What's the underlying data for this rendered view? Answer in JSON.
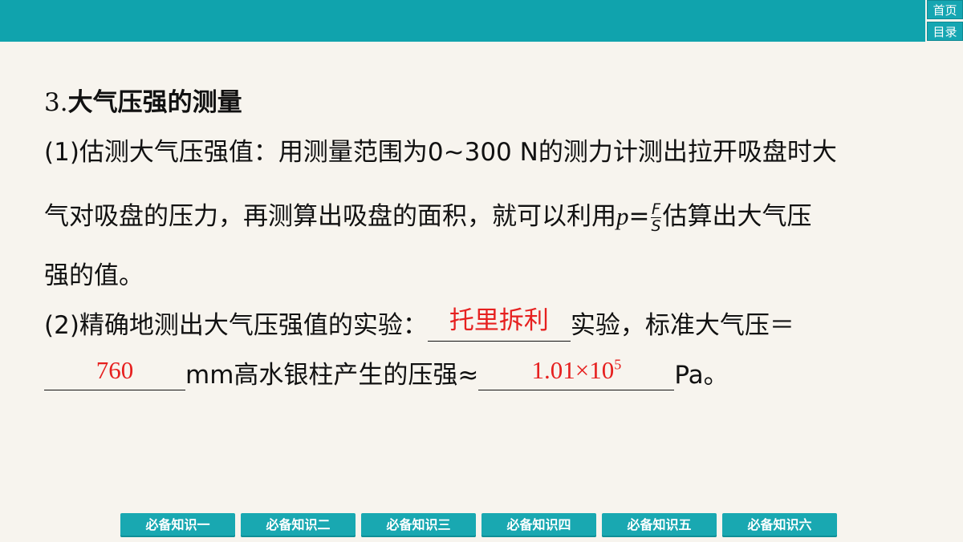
{
  "header": {
    "home_label": "首页",
    "toc_label": "目录",
    "bar_color": "#10a3ad"
  },
  "section": {
    "number": "3.",
    "title": "大气压强的测量"
  },
  "paragraph1": {
    "line1": "(1)估测大气压强值：用测量范围为0~300 N的测力计测出拉开吸盘时大",
    "line2_pre": "气对吸盘的压力，再测算出吸盘的面积，就可以利用",
    "formula_var": "p",
    "formula_eq": "=",
    "formula_num": "F",
    "formula_den": "S",
    "line2_post": "估算出大气压",
    "line3": "强的值。"
  },
  "paragraph2": {
    "line1_pre": "(2)精确地测出大气压强值的实验：",
    "answer1": "托里拆利",
    "line1_post": "实验，标准大气压＝",
    "answer2": "760",
    "line2_mid": "mm高水银柱产生的压强≈",
    "answer3_base": "1.01×10",
    "answer3_exp": "5",
    "line2_post": "Pa。",
    "answer_color": "#e6201f"
  },
  "bottom_nav": {
    "items": [
      "必备知识一",
      "必备知识二",
      "必备知识三",
      "必备知识四",
      "必备知识五",
      "必备知识六"
    ]
  }
}
